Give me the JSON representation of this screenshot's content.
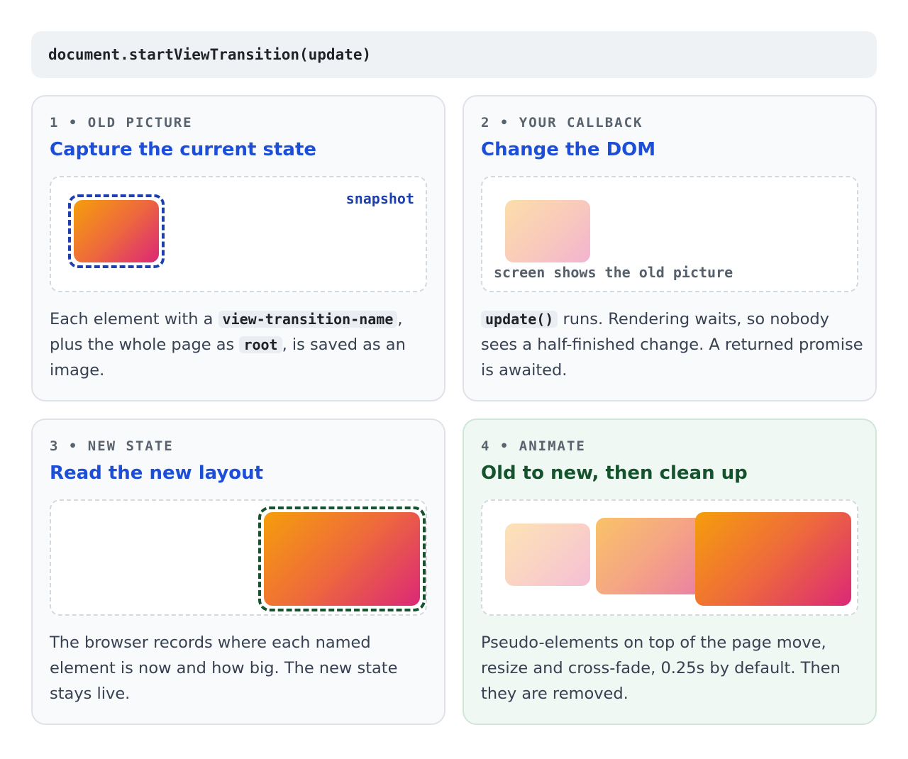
{
  "code": "document.startViewTransition(update)",
  "cards": [
    {
      "step": "1 • OLD PICTURE",
      "title": "Capture the current state",
      "stage_label": "snapshot",
      "desc": {
        "t1": "Each element with a ",
        "c1": "view-transition-name",
        "t2": ", plus the whole page as ",
        "c2": "root",
        "t3": ", is saved as an image."
      }
    },
    {
      "step": "2 • YOUR CALLBACK",
      "title": "Change the DOM",
      "stage_label": "screen shows the old picture",
      "desc": {
        "c1": "update()",
        "t1": " runs. Rendering waits, so nobody sees a half-finished change. A returned promise is awaited."
      }
    },
    {
      "step": "3 • NEW STATE",
      "title": "Read the new layout",
      "desc": {
        "t1": "The browser records where each named element is now and how big. The new state stays live."
      }
    },
    {
      "step": "4 • ANIMATE",
      "title": "Old to new, then clean up",
      "desc": {
        "t1": "Pseudo-elements on top of the page move, resize and cross-fade, 0.25s by default. Then they are removed."
      }
    }
  ],
  "colors": {
    "title_blue": "#1d4ed8",
    "title_green": "#14532d",
    "snapshot_border": "#1e40af",
    "new_state_border": "#14532d",
    "gradient_start": "#f59e0b",
    "gradient_end": "#db2777"
  }
}
